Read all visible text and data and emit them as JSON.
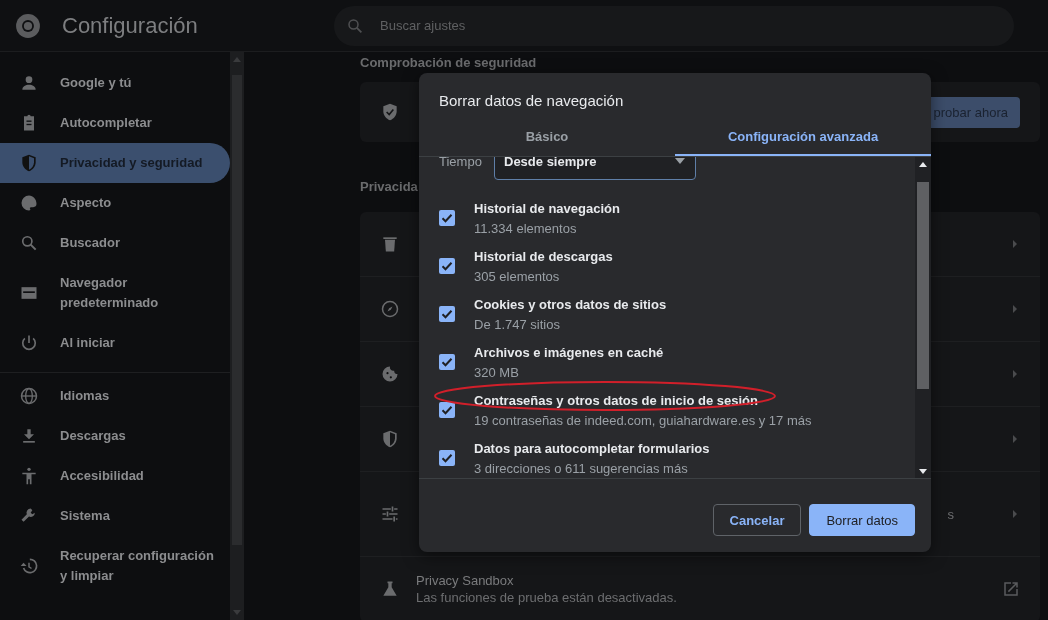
{
  "header": {
    "title": "Configuración",
    "search": {
      "placeholder": "Buscar ajustes"
    }
  },
  "sidebar": {
    "groups": [
      [
        {
          "label": "Google y tú",
          "selected": false
        },
        {
          "label": "Autocompletar",
          "selected": false
        },
        {
          "label": "Privacidad y seguridad",
          "selected": true
        },
        {
          "label": "Aspecto",
          "selected": false
        },
        {
          "label": "Buscador",
          "selected": false
        },
        {
          "label": "Navegador predeterminado",
          "selected": false
        },
        {
          "label": "Al iniciar",
          "selected": false
        }
      ],
      [
        {
          "label": "Idiomas",
          "selected": false
        },
        {
          "label": "Descargas",
          "selected": false
        },
        {
          "label": "Accesibilidad",
          "selected": false
        },
        {
          "label": "Sistema",
          "selected": false
        },
        {
          "label": "Recuperar configuración y limpiar",
          "selected": false
        }
      ]
    ]
  },
  "main": {
    "section_1_heading": "Comprobación de seguridad",
    "safety_card": {
      "button": "probar ahora"
    },
    "section_2_heading": "Privacida",
    "rows": [
      {
        "kind": "chevron"
      },
      {
        "kind": "chevron"
      },
      {
        "kind": "chevron"
      },
      {
        "kind": "chevron"
      },
      {
        "kind": "chevron",
        "line_end": "s"
      },
      {
        "kind": "external",
        "title": "Privacy Sandbox",
        "lines": [
          "Las funciones de prueba están desactivadas."
        ]
      }
    ]
  },
  "dialog": {
    "title": "Borrar datos de navegación",
    "tabs": [
      {
        "label": "Básico",
        "selected": false
      },
      {
        "label": "Configuración avanzada",
        "selected": true
      }
    ],
    "time_label": "Tiempo",
    "time_value": "Desde siempre",
    "items": [
      {
        "title": "Historial de navegación",
        "detail": "11.334 elementos",
        "checked": true,
        "circled": false
      },
      {
        "title": "Historial de descargas",
        "detail": "305 elementos",
        "checked": true,
        "circled": false
      },
      {
        "title": "Cookies y otros datos de sitios",
        "detail": "De 1.747 sitios",
        "checked": true,
        "circled": false
      },
      {
        "title": "Archivos e imágenes en caché",
        "detail": "320 MB",
        "checked": true,
        "circled": false
      },
      {
        "title": "Contraseñas y otros datos de inicio de sesión",
        "detail": "19 contraseñas de indeed.com, guiahardware.es y 17 más",
        "checked": true,
        "circled": true
      },
      {
        "title": "Datos para autocompletar formularios",
        "detail": "3 direcciones o 611 sugerencias más",
        "checked": true,
        "circled": false
      }
    ],
    "buttons": [
      {
        "label": "Cancelar",
        "kind": "secondary"
      },
      {
        "label": "Borrar datos",
        "kind": "primary"
      }
    ]
  }
}
